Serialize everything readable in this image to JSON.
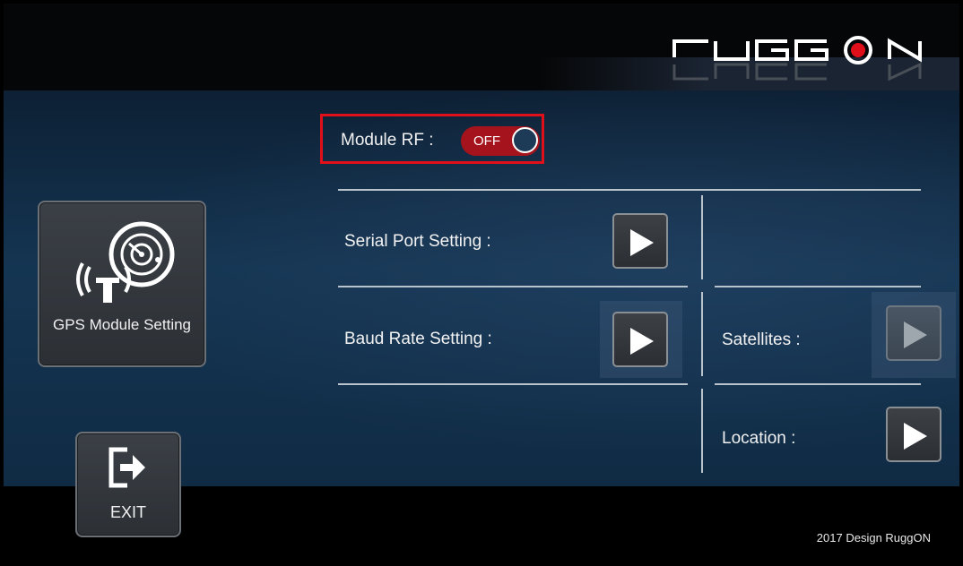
{
  "brand": {
    "logo_text": "RuggON"
  },
  "footer": {
    "text": "2017 Design RuggON"
  },
  "sidebar": {
    "gps_tile": {
      "label": "GPS Module Setting",
      "icon": "gps-antenna-radar-icon"
    },
    "exit_tile": {
      "label": "EXIT",
      "icon": "exit-door-icon"
    }
  },
  "module_rf": {
    "label": "Module RF :",
    "toggle_state": "OFF",
    "highlight_color": "#e0101a",
    "toggle_color": "#a5141c"
  },
  "settings": {
    "serial_port": {
      "label": "Serial Port Setting :",
      "icon": "play-arrow-icon"
    },
    "baud_rate": {
      "label": "Baud Rate Setting :",
      "icon": "play-arrow-icon"
    },
    "satellites": {
      "label": "Satellites :",
      "icon": "play-arrow-icon",
      "enabled": false
    },
    "location": {
      "label": "Location :",
      "icon": "play-arrow-icon"
    }
  }
}
